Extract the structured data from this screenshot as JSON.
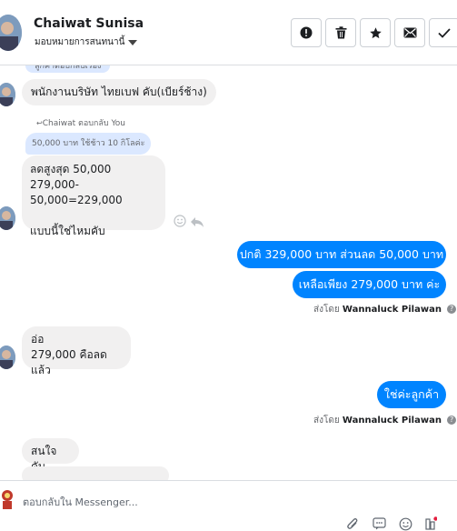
{
  "header": {
    "contact_name": "Chaiwat Sunisa",
    "assign_label": "มอบหมายการสนทนานี้"
  },
  "thread": {
    "partial_top_text": "ลูกค้าตอบกลับเรื่อง",
    "msg1": "พนักงานบริษัท ไทยเบฟ คับ(เบียร์ช้าง)",
    "reply_label": "Chaiwat ตอบกลับ You",
    "quoted": "50,000 บาท ใช้ช้าว 10 กิโลค่ะ",
    "msg2": "ลดสูงสุด 50,000\n279,000-50,000=229,000\n\nแบบนี้ใช่ไหมคับ",
    "out1": "ปกติ 329,000 บาท  ส่วนลด 50,000 บาท",
    "out2": "เหลือเพียง 279,000 บาท  ค่ะ",
    "sent_by_prefix": "ส่งโดย",
    "sender": "Wannaluck Pilawan",
    "msg3": "อ่อ\n279,000 คือลดแล้ว",
    "out3": "ใช่ค่ะลูกค้า",
    "msg4": "สนใจคับ"
  },
  "composer": {
    "placeholder": "ตอบกลับใน Messenger..."
  },
  "colors": {
    "outgoing": "#0084ff",
    "incoming": "#f1f0f0",
    "quote": "#dbe8ff",
    "notify_dot": "#e41e3f"
  },
  "icons": [
    "alert-icon",
    "trash-icon",
    "star-icon",
    "mail-icon",
    "check-icon",
    "smile-icon",
    "reply-icon",
    "info-icon",
    "attach-icon",
    "sticker-icon",
    "emoji-icon",
    "gif-icon"
  ]
}
